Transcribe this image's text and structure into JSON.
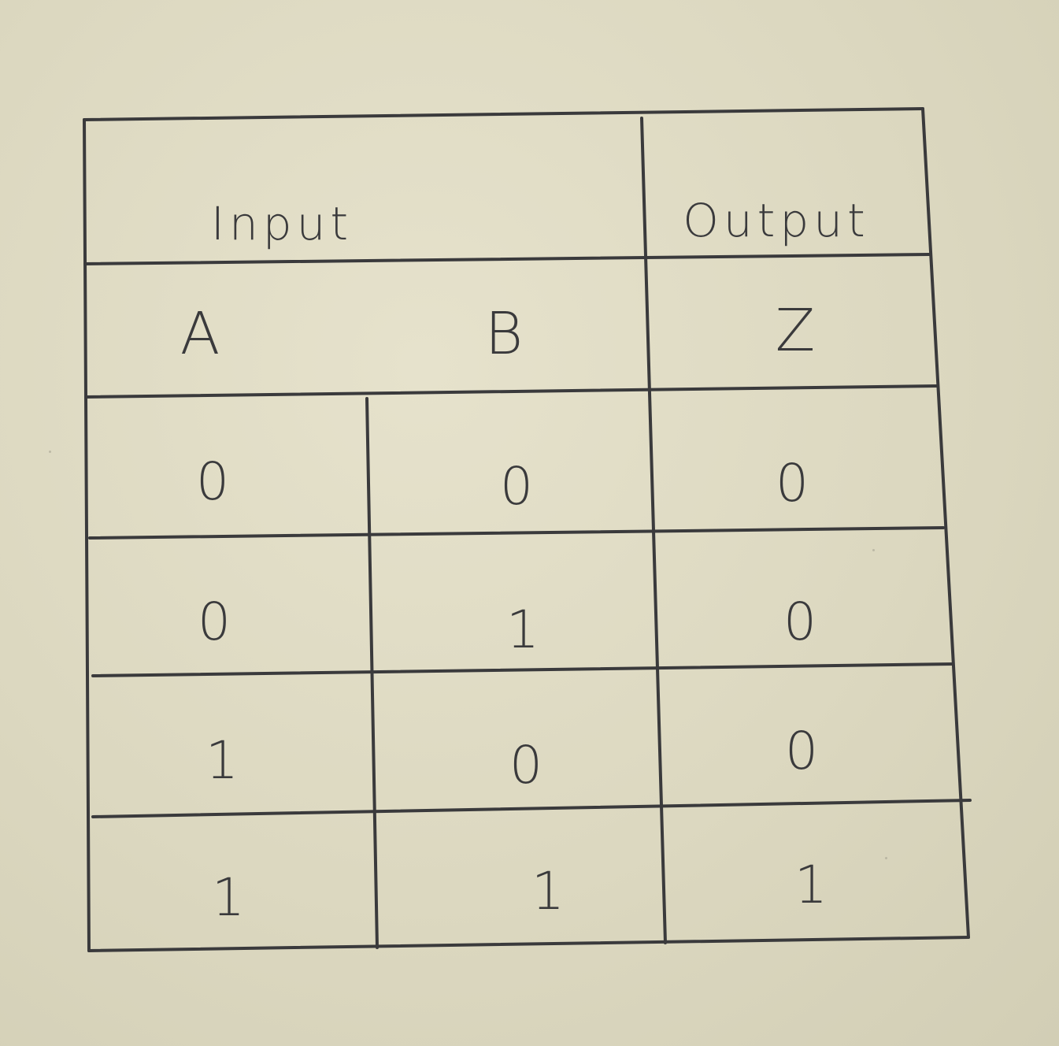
{
  "table": {
    "group_headers": {
      "input": "Input",
      "output": "Output"
    },
    "columns": [
      "A",
      "B",
      "Z"
    ],
    "rows": [
      [
        "0",
        "0",
        "0"
      ],
      [
        "0",
        "1",
        "0"
      ],
      [
        "1",
        "0",
        "0"
      ],
      [
        "1",
        "1",
        "1"
      ]
    ]
  },
  "colors": {
    "ink": "#3a3a3c",
    "paper": "#e2dec7"
  }
}
